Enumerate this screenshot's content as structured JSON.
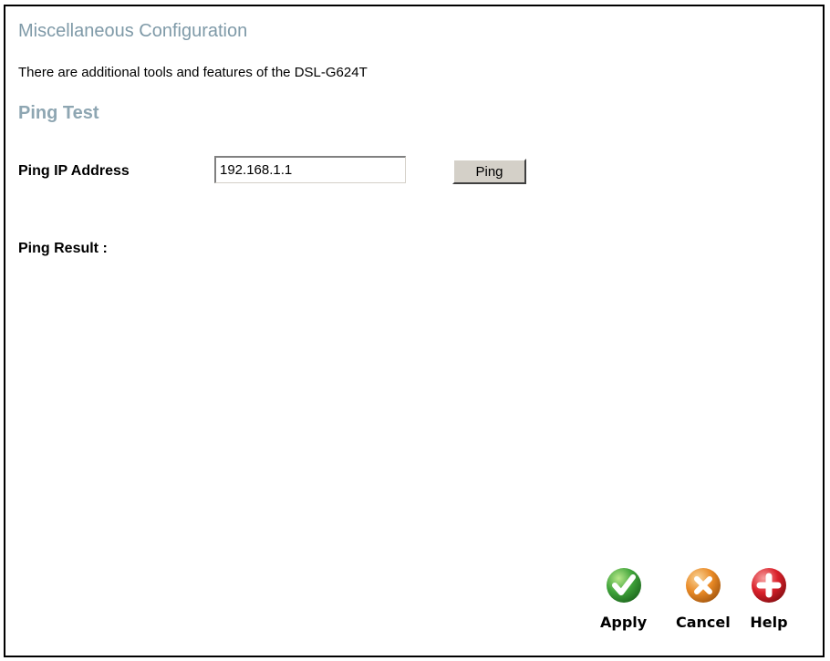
{
  "page": {
    "title": "Miscellaneous Configuration",
    "description": "There are additional tools and features of the DSL-G624T"
  },
  "ping_test": {
    "section_title": "Ping Test",
    "ip_label": "Ping IP Address",
    "ip_value": "192.168.1.1",
    "ping_button": "Ping",
    "result_label": "Ping Result :"
  },
  "actions": {
    "apply": {
      "label": "Apply",
      "icon": "checkmark-icon",
      "color": "#3fa33a"
    },
    "cancel": {
      "label": "Cancel",
      "icon": "x-icon",
      "color": "#e98a26"
    },
    "help": {
      "label": "Help",
      "icon": "plus-icon",
      "color": "#d9202a"
    }
  }
}
